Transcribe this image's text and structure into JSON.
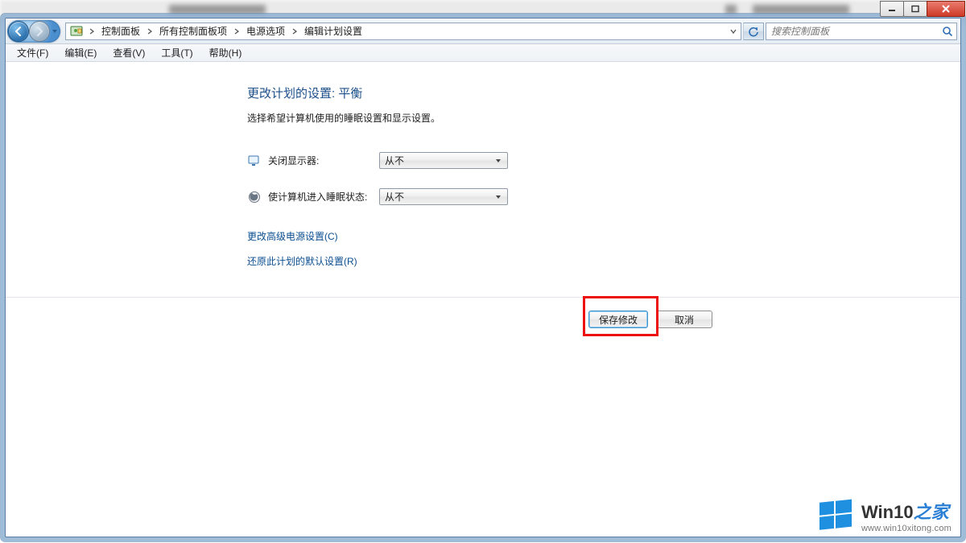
{
  "window_controls": {
    "minimize": "min",
    "maximize": "max",
    "close": "close"
  },
  "breadcrumb": {
    "items": [
      "控制面板",
      "所有控制面板项",
      "电源选项",
      "编辑计划设置"
    ]
  },
  "search": {
    "placeholder": "搜索控制面板"
  },
  "menu": {
    "file": "文件(F)",
    "edit": "编辑(E)",
    "view": "查看(V)",
    "tools": "工具(T)",
    "help": "帮助(H)"
  },
  "page": {
    "heading": "更改计划的设置: 平衡",
    "subtext": "选择希望计算机使用的睡眠设置和显示设置。",
    "settings": {
      "display_off_label": "关闭显示器:",
      "display_off_value": "从不",
      "sleep_label": "使计算机进入睡眠状态:",
      "sleep_value": "从不"
    },
    "links": {
      "advanced": "更改高级电源设置(C)",
      "restore": "还原此计划的默认设置(R)"
    },
    "buttons": {
      "save": "保存修改",
      "cancel": "取消"
    }
  },
  "watermark": {
    "brand_pre": "Win10",
    "brand_suf": "之家",
    "url": "www.win10xitong.com"
  }
}
